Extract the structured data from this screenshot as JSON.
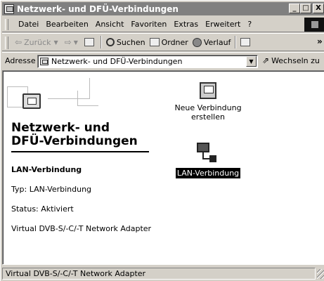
{
  "window": {
    "title": "Netzwerk- und DFÜ-Verbindungen",
    "controls": {
      "minimize": "_",
      "maximize": "□",
      "close": "X"
    }
  },
  "menu": {
    "items": [
      "Datei",
      "Bearbeiten",
      "Ansicht",
      "Favoriten",
      "Extras",
      "Erweitert",
      "?"
    ]
  },
  "toolbar": {
    "back_label": "Zurück",
    "search_label": "Suchen",
    "folders_label": "Ordner",
    "history_label": "Verlauf",
    "more": "»"
  },
  "address": {
    "label": "Adresse",
    "value": "Netzwerk- und DFÜ-Verbindungen",
    "go_label": "Wechseln zu"
  },
  "panel": {
    "heading_line1": "Netzwerk- und",
    "heading_line2": "DFÜ-Verbindungen",
    "selected_title": "LAN-Verbindung",
    "type_line": "Typ: LAN-Verbindung",
    "status_line": "Status: Aktiviert",
    "adapter_line": "Virtual DVB-S/-C/-T Network Adapter"
  },
  "items": {
    "new_connection_line1": "Neue Verbindung",
    "new_connection_line2": "erstellen",
    "lan_connection": "LAN-Verbindung"
  },
  "statusbar": {
    "text": "Virtual DVB-S/-C/-T Network Adapter"
  }
}
